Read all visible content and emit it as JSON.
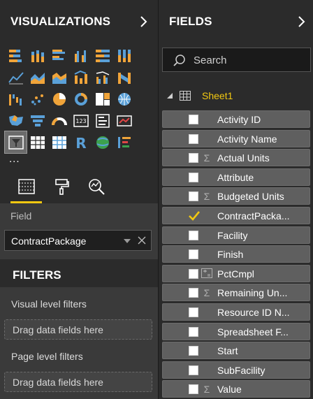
{
  "visualizations": {
    "title": "VISUALIZATIONS",
    "more_label": "...",
    "icons": [
      [
        "stacked-bar-chart-icon",
        "stacked-column-chart-icon",
        "clustered-bar-chart-icon",
        "clustered-column-chart-icon",
        "100-stacked-bar-chart-icon",
        "100-stacked-column-chart-icon"
      ],
      [
        "line-chart-icon",
        "area-chart-icon",
        "stacked-area-chart-icon",
        "line-and-stacked-column-chart-icon",
        "line-and-clustered-column-chart-icon",
        "ribbon-chart-icon"
      ],
      [
        "waterfall-chart-icon",
        "scatter-chart-icon",
        "pie-chart-icon",
        "donut-chart-icon",
        "treemap-icon",
        "map-icon"
      ],
      [
        "filled-map-icon",
        "funnel-icon",
        "gauge-icon",
        "card-icon",
        "multi-row-card-icon",
        "kpi-icon"
      ],
      [
        "slicer-icon",
        "table-icon",
        "matrix-icon",
        "r-script-visual-icon",
        "arcgis-map-icon",
        "custom-visual-icon"
      ]
    ],
    "selected_icon": "slicer-icon"
  },
  "tabs": {
    "fields_tab": "fields-tab-icon",
    "format_tab": "format-paint-roller-icon",
    "analytics_tab": "analytics-magnifier-icon",
    "active": "fields"
  },
  "field_well": {
    "label": "Field",
    "value": "ContractPackage"
  },
  "filters": {
    "title": "FILTERS",
    "visual_level_label": "Visual level filters",
    "visual_drop_hint": "Drag data fields here",
    "page_level_label": "Page level filters",
    "page_drop_hint": "Drag data fields here"
  },
  "fields_pane": {
    "title": "FIELDS",
    "search_placeholder": "Search",
    "table_name": "Sheet1",
    "fields": [
      {
        "name": "Activity ID",
        "type": "text",
        "checked": false
      },
      {
        "name": "Activity Name",
        "type": "text",
        "checked": false
      },
      {
        "name": "Actual Units",
        "type": "sum",
        "checked": false
      },
      {
        "name": "Attribute",
        "type": "text",
        "checked": false
      },
      {
        "name": "Budgeted Units",
        "type": "sum",
        "checked": false
      },
      {
        "name": "ContractPacka...",
        "type": "text",
        "checked": true
      },
      {
        "name": "Facility",
        "type": "text",
        "checked": false
      },
      {
        "name": "Finish",
        "type": "text",
        "checked": false
      },
      {
        "name": "PctCmpl",
        "type": "calc",
        "checked": false
      },
      {
        "name": "Remaining Un...",
        "type": "sum",
        "checked": false
      },
      {
        "name": "Resource ID N...",
        "type": "text",
        "checked": false
      },
      {
        "name": "Spreadsheet F...",
        "type": "text",
        "checked": false
      },
      {
        "name": "Start",
        "type": "text",
        "checked": false
      },
      {
        "name": "SubFacility",
        "type": "text",
        "checked": false
      },
      {
        "name": "Value",
        "type": "sum",
        "checked": false
      }
    ]
  },
  "colors": {
    "accent": "#f2c811",
    "pane_bg": "#2b2b2b",
    "row_bg": "#5f5f5f",
    "viz_orange": "#f0a43a",
    "viz_blue": "#5aa0d8"
  }
}
